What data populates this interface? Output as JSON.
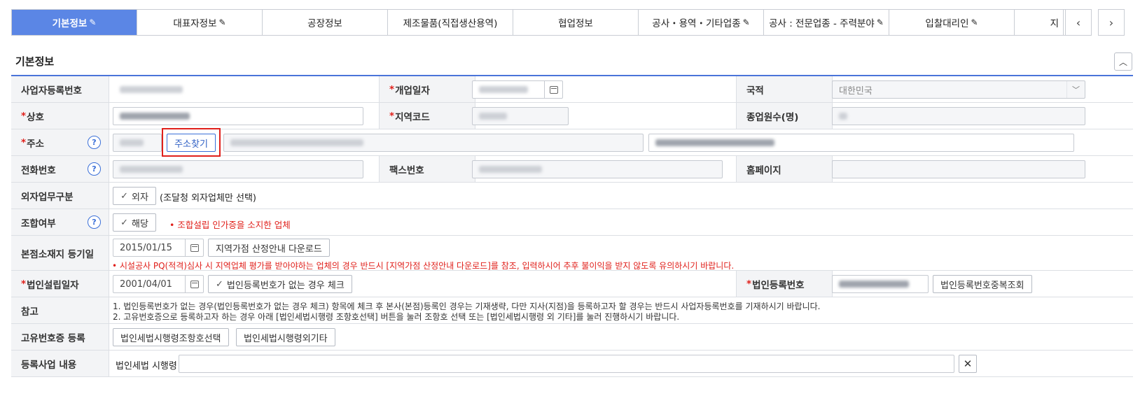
{
  "tabs": [
    {
      "label": "기본정보",
      "edit_icon": "pencil-icon",
      "active": true
    },
    {
      "label": "대표자정보",
      "edit_icon": "pencil-icon",
      "active": false
    },
    {
      "label": "공장정보",
      "edit_icon": "",
      "active": false
    },
    {
      "label": "제조물품(직접생산용역)",
      "edit_icon": "",
      "active": false
    },
    {
      "label": "협업정보",
      "edit_icon": "",
      "active": false
    },
    {
      "label": "공사・용역・기타업종",
      "edit_icon": "pencil-icon",
      "active": false
    },
    {
      "label": "공사 : 전문업종 - 주력분야",
      "edit_icon": "pencil-icon",
      "active": false
    },
    {
      "label": "입찰대리인",
      "edit_icon": "pencil-icon",
      "active": false
    },
    {
      "label": "지",
      "edit_icon": "",
      "active": false
    }
  ],
  "tab_nav": {
    "prev": "‹",
    "next": "›"
  },
  "section": {
    "title": "기본정보",
    "collapse_icon": "chevron-up-icon"
  },
  "form": {
    "business_reg_no": {
      "label": "사업자등록번호"
    },
    "open_date": {
      "label": "개업일자",
      "required": "*"
    },
    "nationality": {
      "label": "국적",
      "value": "대한민국"
    },
    "company_name": {
      "label": "상호",
      "required": "*"
    },
    "region_code": {
      "label": "지역코드",
      "required": "*"
    },
    "employees": {
      "label": "종업원수(명)"
    },
    "address": {
      "label": "주소",
      "required": "*",
      "search_button": "주소찾기"
    },
    "phone": {
      "label": "전화번호"
    },
    "fax": {
      "label": "팩스번호"
    },
    "homepage": {
      "label": "홈페이지"
    },
    "outsourcing": {
      "label": "외자업무구분",
      "check_label": "외자",
      "note": "(조달청 외자업체만 선택)"
    },
    "union": {
      "label": "조합여부",
      "check_label": "해당",
      "note": "• 조합설립 인가증을 소지한 업체"
    },
    "hq_reg_date": {
      "label": "본점소재지 등기일",
      "value": "2015/01/15",
      "button": "지역가점 산정안내 다운로드",
      "note": "• 시설공사 PQ(적격)심사 시 지역업체 평가를 받아야하는 업체의 경우 반드시 [지역가점 산정안내 다운로드]를 참조, 입력하시어 추후 불이익을 받지 않도록 유의하시기 바랍니다."
    },
    "corp_est_date": {
      "label": "법인설립일자",
      "required": "*",
      "value": "2001/04/01",
      "check_button": "법인등록번호가 없는 경우 체크"
    },
    "corp_reg_no": {
      "label": "법인등록번호",
      "required": "*",
      "button": "법인등록번호중복조회"
    },
    "reference": {
      "label": "참고",
      "line1": "1. 법인등록번호가 없는 경우(법인등록번호가 없는 경우 체크) 항목에 체크 후 본사(본점)등록인 경우는 기재생략, 다만 지사(지점)을 등록하고자 할 경우는 반드시 사업자등록번호를 기재하시기 바랍니다.",
      "line2": "2. 고유번호증으로 등록하고자 하는 경우 아래 [법인세법시행령 조항호선택] 버튼을 눌러 조항호 선택 또는 [법인세법시행령 외 기타]를 눌러 진행하시기 바랍니다."
    },
    "unique_no": {
      "label": "고유번호증 등록",
      "button1": "법인세법시행령조항호선택",
      "button2": "법인세법시행령외기타"
    },
    "registered_business": {
      "label": "등록사업 내용",
      "prefix": "법인세법 시행령",
      "clear_icon": "close-icon"
    }
  },
  "colors": {
    "accent": "#5b86e5",
    "required": "#e0201b",
    "label_bg": "#f3f4f6"
  }
}
